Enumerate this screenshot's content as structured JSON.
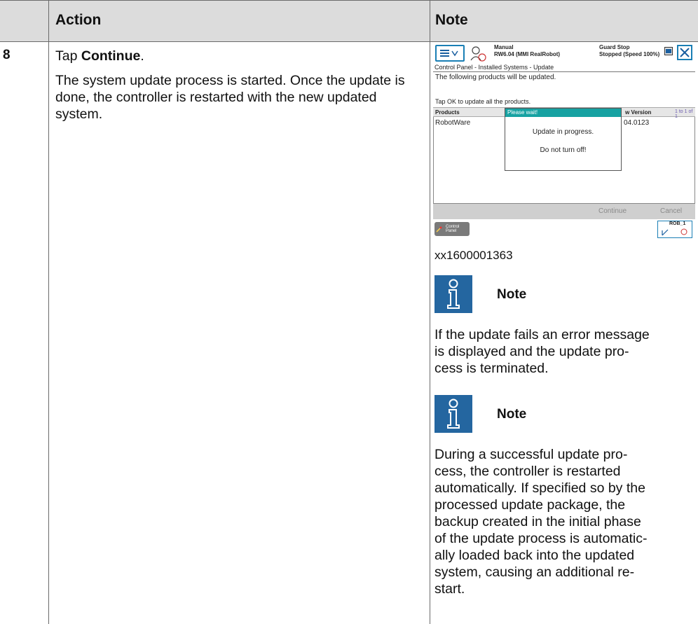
{
  "table": {
    "header": {
      "action": "Action",
      "note": "Note"
    },
    "row": {
      "step": "8",
      "action_prefix": "Tap ",
      "action_bold": "Continue",
      "action_suffix": ".",
      "action_detail": "The system update process is started. Once the update is done, the controller is restarted with the new updated system."
    }
  },
  "screenshot": {
    "status_mode": "Manual",
    "status_system": "RW6.04 (MMI RealRobot)",
    "status_guard": "Guard Stop",
    "status_speed": "Stopped (Speed 100%)",
    "breadcrumb": "Control Panel - Installed Systems - Update",
    "message1": "The following products will be updated.",
    "message2": "Tap OK to update all the products.",
    "col_products": "Products",
    "col_version": "w Version",
    "col_page": "1 to 1 of 1",
    "row_product": "RobotWare",
    "row_version": "04.0123",
    "dialog_title": "Please wait!",
    "dialog_line1": "Update in progress.",
    "dialog_line2": "Do not turn off!",
    "btn_continue": "Continue",
    "btn_cancel": "Cancel",
    "task_control": "Control",
    "task_panel": "Panel",
    "rob_label": "ROB_1",
    "icons": [
      "menu-icon",
      "chevron-down-icon",
      "user-icon",
      "window-icon",
      "close-icon",
      "wrench-icon",
      "robot-mechunit-icon"
    ]
  },
  "caption": "xx1600001363",
  "notes": [
    {
      "title": "Note",
      "lines": [
        "If the update fails an error message",
        "is displayed and the update pro-",
        "cess is terminated."
      ]
    },
    {
      "title": "Note",
      "lines": [
        "During a successful update pro-",
        "cess, the controller is restarted",
        "automatically. If specified so by the",
        "processed update package, the",
        "backup created in the initial phase",
        "of the update process is automatic-",
        "ally loaded back into the updated",
        "system, causing an additional re-",
        "start."
      ]
    }
  ],
  "colors": {
    "header_bg": "#dcdcdc",
    "note_icon": "#2466a0",
    "dialog_title": "#17a2a2"
  }
}
